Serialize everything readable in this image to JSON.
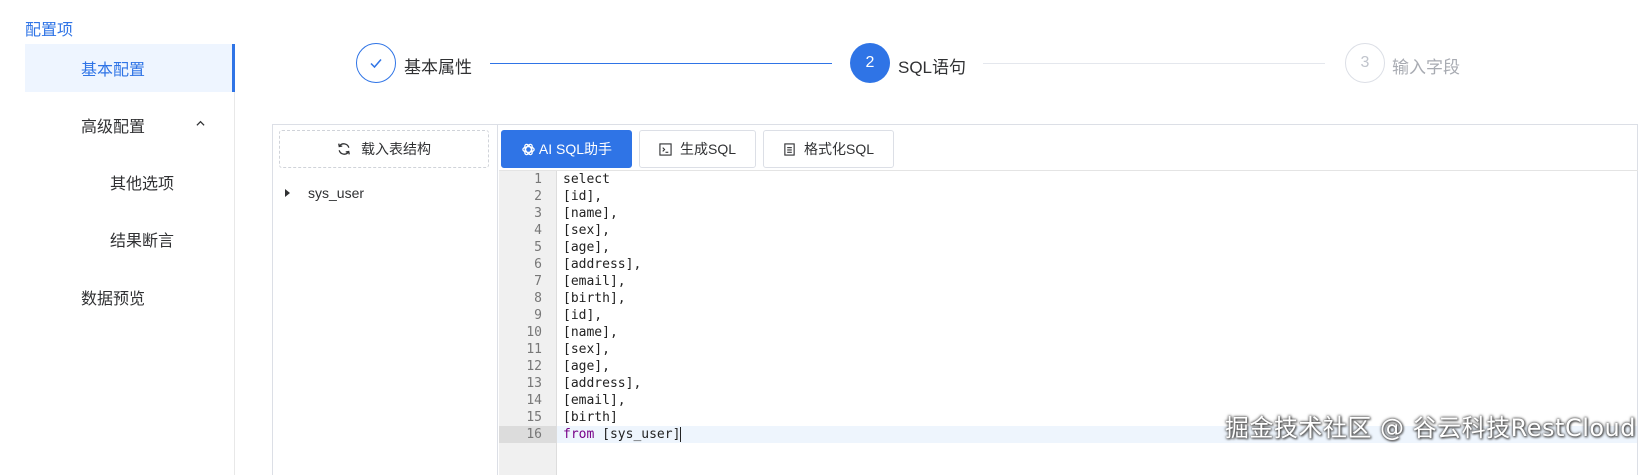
{
  "sidebar": {
    "title": "配置项",
    "items": [
      {
        "label": "基本配置"
      },
      {
        "label": "高级配置"
      },
      {
        "label": "其他选项"
      },
      {
        "label": "结果断言"
      },
      {
        "label": "数据预览"
      }
    ]
  },
  "steps": [
    {
      "number": "",
      "label": "基本属性",
      "status": "done"
    },
    {
      "number": "2",
      "label": "SQL语句",
      "status": "active"
    },
    {
      "number": "3",
      "label": "输入字段",
      "status": "pending"
    }
  ],
  "left_pane": {
    "load_button_label": "载入表结构",
    "tree": [
      {
        "label": "sys_user"
      }
    ]
  },
  "toolbar": {
    "ai_button_label": "AI SQL助手",
    "generate_button_label": "生成SQL",
    "format_button_label": "格式化SQL"
  },
  "editor": {
    "line_numbers": [
      "1",
      "2",
      "3",
      "4",
      "5",
      "6",
      "7",
      "8",
      "9",
      "10",
      "11",
      "12",
      "13",
      "14",
      "15",
      "16"
    ],
    "lines": [
      "select",
      "[id],",
      "[name],",
      "[sex],",
      "[age],",
      "[address],",
      "[email],",
      "[birth],",
      "[id],",
      "[name],",
      "[sex],",
      "[age],",
      "[address],",
      "[email],",
      "[birth]",
      "from [sys_user]"
    ]
  },
  "watermark": "掘金技术社区 @ 谷云科技RestCloud",
  "colors": {
    "accent": "#2f74e6",
    "active_bg": "#eef5ff",
    "keyword": "#770088"
  }
}
